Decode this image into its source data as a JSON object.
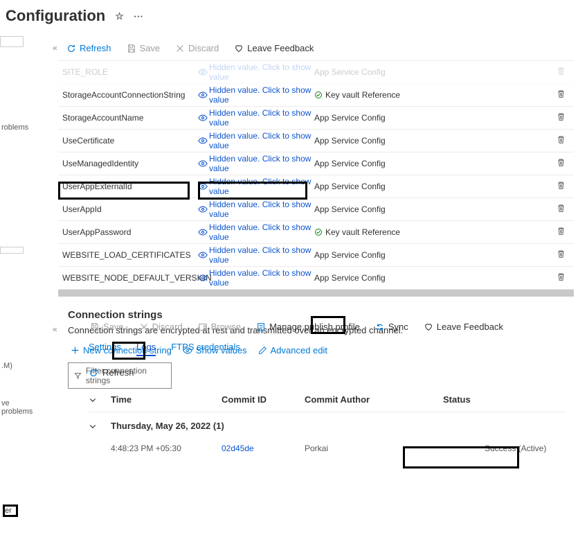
{
  "page": {
    "title": "Configuration"
  },
  "left_sidebar": {
    "items": [
      "roblems",
      ".M)",
      "ve problems"
    ],
    "bottom_item": "er"
  },
  "upper_toolbar": {
    "refresh": "Refresh",
    "save": "Save",
    "discard": "Discard",
    "leave_feedback": "Leave Feedback"
  },
  "settings_rows": [
    {
      "name": "SITE_ROLE",
      "value_label": "Hidden value. Click to show value",
      "source": "App Service Config",
      "keyvault": false
    },
    {
      "name": "StorageAccountConnectionString",
      "value_label": "Hidden value. Click to show value",
      "source": "Key vault Reference",
      "keyvault": true
    },
    {
      "name": "StorageAccountName",
      "value_label": "Hidden value. Click to show value",
      "source": "App Service Config",
      "keyvault": false
    },
    {
      "name": "UseCertificate",
      "value_label": "Hidden value. Click to show value",
      "source": "App Service Config",
      "keyvault": false
    },
    {
      "name": "UseManagedIdentity",
      "value_label": "Hidden value. Click to show value",
      "source": "App Service Config",
      "keyvault": false
    },
    {
      "name": "UserAppExternalId",
      "value_label": "Hidden value. Click to show value",
      "source": "App Service Config",
      "keyvault": false
    },
    {
      "name": "UserAppId",
      "value_label": "Hidden value. Click to show value",
      "source": "App Service Config",
      "keyvault": false
    },
    {
      "name": "UserAppPassword",
      "value_label": "Hidden value. Click to show value",
      "source": "Key vault Reference",
      "keyvault": true
    },
    {
      "name": "WEBSITE_LOAD_CERTIFICATES",
      "value_label": "Hidden value. Click to show value",
      "source": "App Service Config",
      "keyvault": false
    },
    {
      "name": "WEBSITE_NODE_DEFAULT_VERSION",
      "value_label": "Hidden value. Click to show value",
      "source": "App Service Config",
      "keyvault": false
    }
  ],
  "conn": {
    "heading": "Connection strings",
    "subheading": "Connection strings are encrypted at rest and transmitted over an encrypted channel.",
    "new_link": "New connection string",
    "show_values": "Show values",
    "advanced_edit": "Advanced edit",
    "filter_placeholder": "Filter connection strings"
  },
  "lower_toolbar": {
    "save": "Save",
    "discard": "Discard",
    "browse": "Browse",
    "manage_profile": "Manage publish profile",
    "sync": "Sync",
    "leave_feedback": "Leave Feedback"
  },
  "tabs": {
    "settings": "Settings",
    "logs": "Logs",
    "ftps": "FTPS credentials"
  },
  "refresh_label": "Refresh",
  "log": {
    "headers": {
      "time": "Time",
      "commit_id": "Commit ID",
      "author": "Commit Author",
      "status": "Status"
    },
    "group_label": "Thursday, May 26, 2022 (1)",
    "entry": {
      "time": "4:48:23 PM +05:30",
      "commit": "02d45de",
      "author": "Porkai",
      "status": "Success (Active)"
    }
  }
}
